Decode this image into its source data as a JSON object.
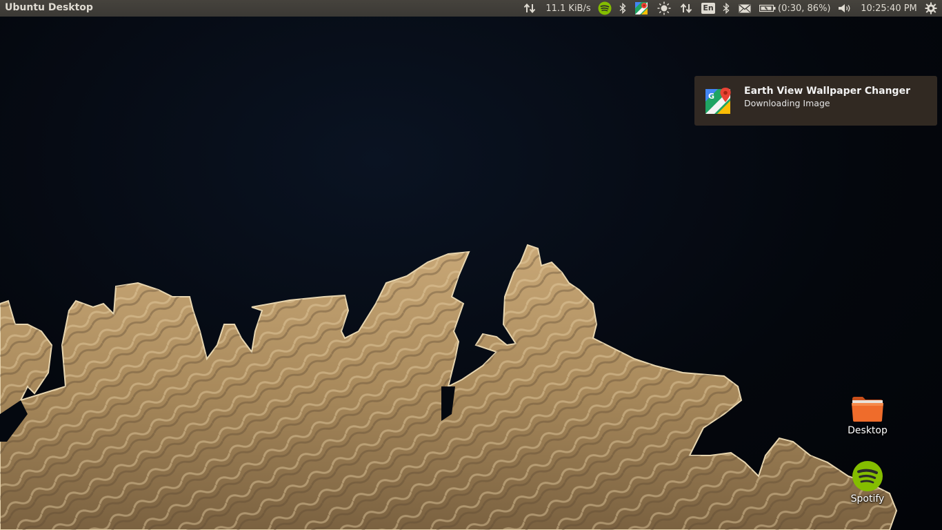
{
  "panel": {
    "title": "Ubuntu Desktop",
    "indicators": [
      {
        "name": "network-arrows-icon"
      },
      {
        "name": "net-speed",
        "text": "11.1 KiB/s"
      },
      {
        "name": "spotify-tray-icon"
      },
      {
        "name": "bluetooth-icon"
      },
      {
        "name": "google-maps-tray-icon"
      },
      {
        "name": "brightness-icon"
      },
      {
        "name": "network-transfer-icon"
      },
      {
        "name": "keyboard-layout",
        "text": "En"
      },
      {
        "name": "bluetooth-icon-2"
      },
      {
        "name": "mail-icon"
      },
      {
        "name": "battery",
        "text": "(0:30, 86%)"
      },
      {
        "name": "volume-icon"
      },
      {
        "name": "clock",
        "text": "10:25:40 PM"
      },
      {
        "name": "power-gear-icon"
      }
    ],
    "net_speed": "11.1 KiB/s",
    "keyboard": "En",
    "battery": "(0:30, 86%)",
    "clock": "10:25:40 PM"
  },
  "notification": {
    "title": "Earth View Wallpaper Changer",
    "body": "Downloading Image",
    "icon": "google-maps-icon"
  },
  "desktop_icons": [
    {
      "label": "Desktop",
      "icon": "folder-icon"
    },
    {
      "label": "Spotify",
      "icon": "spotify-icon"
    }
  ],
  "colors": {
    "panel_bg": "#3c3b37",
    "notification_bg": "#342c24",
    "spotify_green": "#84bd00",
    "folder_orange": "#e9692c"
  }
}
